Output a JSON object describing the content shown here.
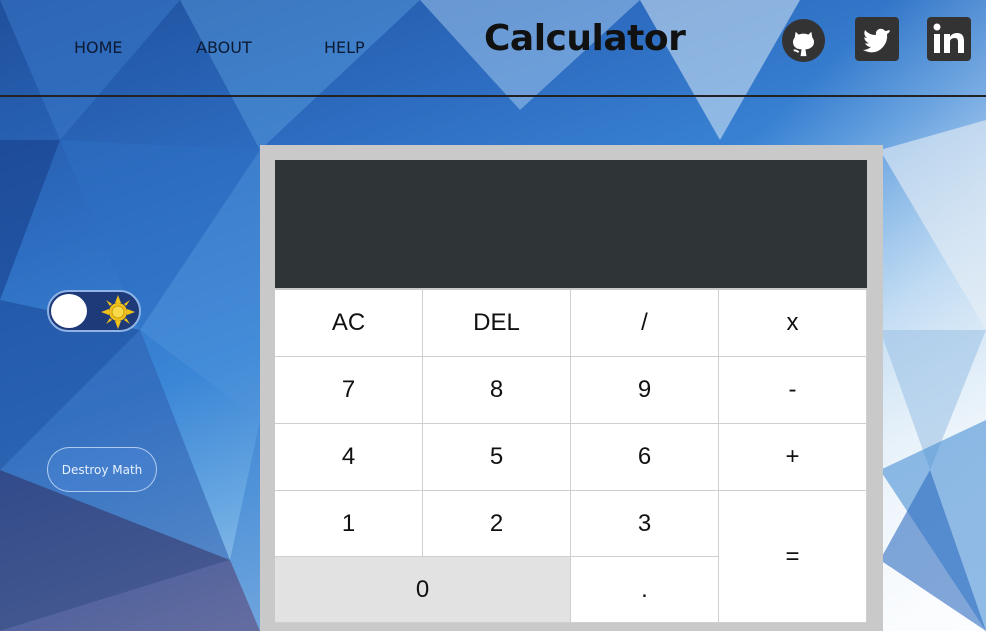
{
  "nav": {
    "home": "HOME",
    "about": "ABOUT",
    "help": "HELP"
  },
  "app_title": "Calculator",
  "social": [
    "github-icon",
    "twitter-icon",
    "linkedin-icon"
  ],
  "theme_toggle": {
    "state": "off",
    "icon": "sun-icon"
  },
  "destroy_button": "Destroy Math",
  "display": {
    "value": ""
  },
  "keys": {
    "ac": "AC",
    "del": "DEL",
    "divide": "/",
    "multiply": "x",
    "seven": "7",
    "eight": "8",
    "nine": "9",
    "minus": "-",
    "four": "4",
    "five": "5",
    "six": "6",
    "plus": "+",
    "one": "1",
    "two": "2",
    "three": "3",
    "equals": "=",
    "zero": "0",
    "dot": "."
  },
  "colors": {
    "display": "#2f3437",
    "frame": "#c9c9c9",
    "zero_key": "#e2e2e2"
  }
}
